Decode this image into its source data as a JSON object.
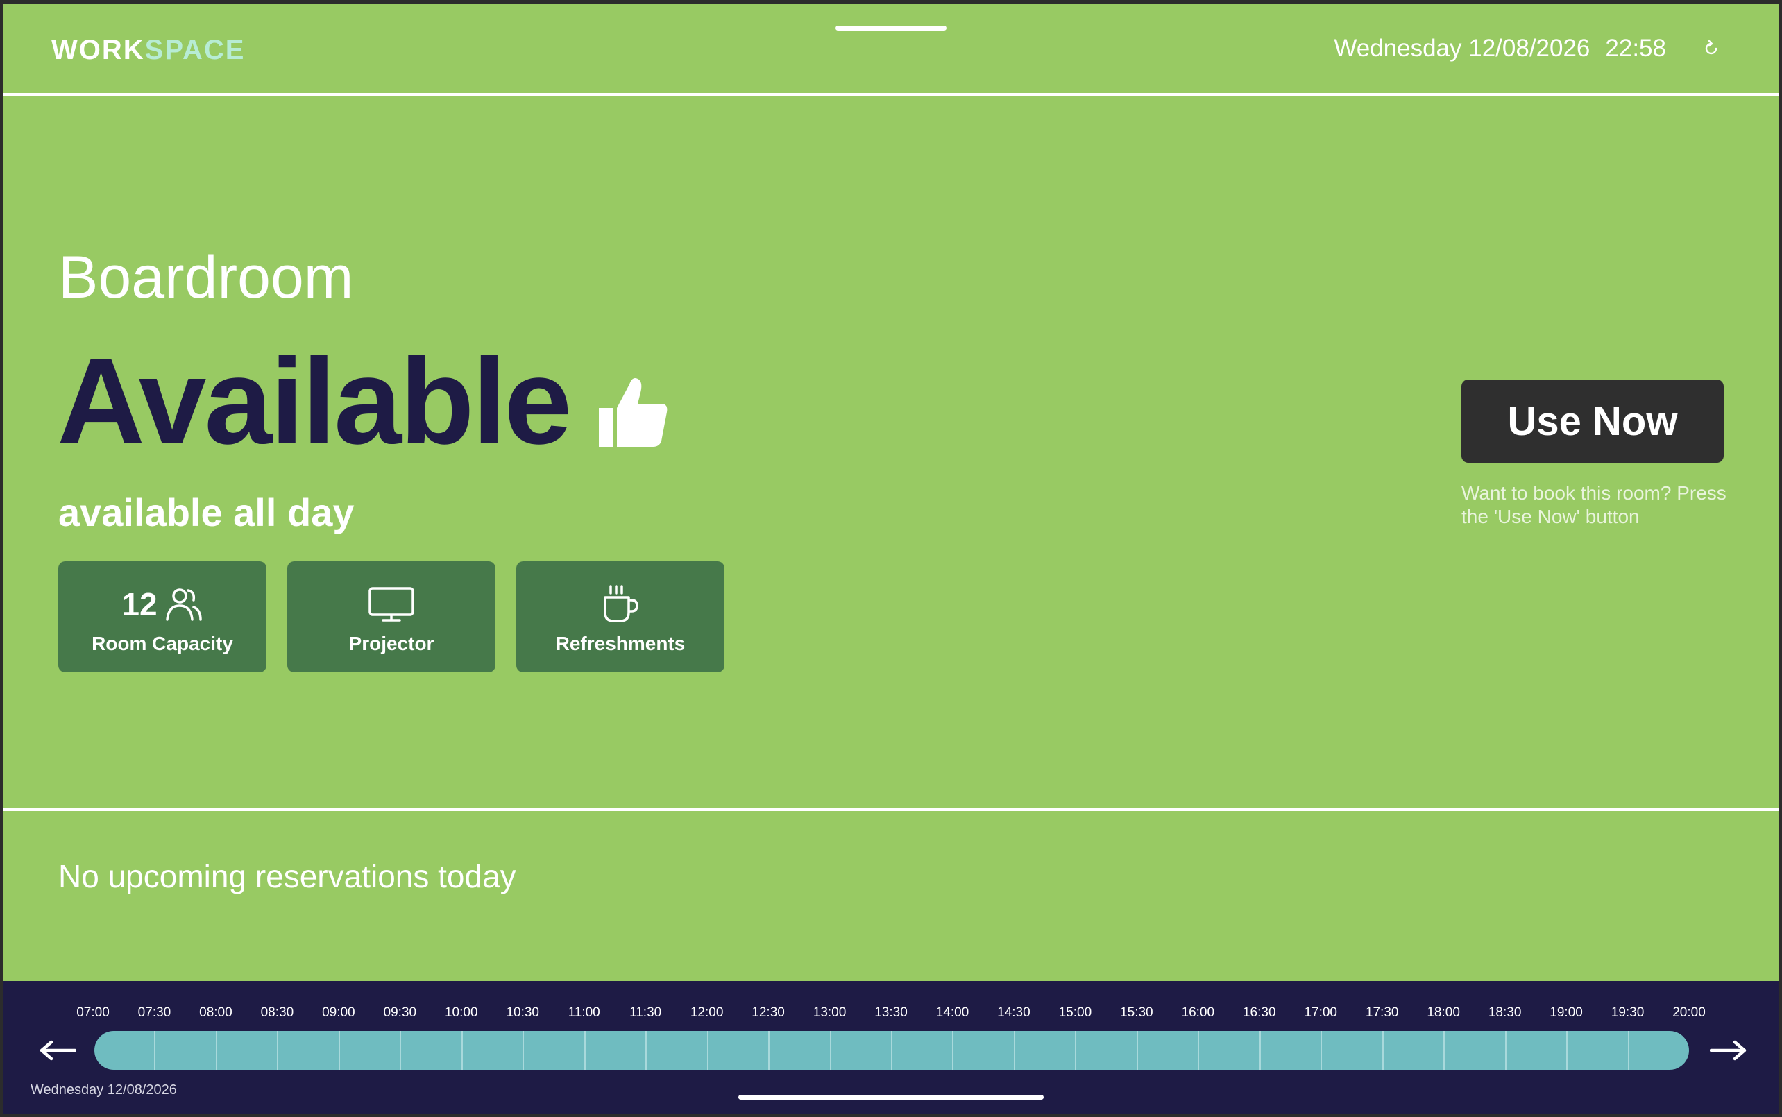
{
  "header": {
    "logo_part1": "WORK",
    "logo_part2": "SPACE",
    "date": "Wednesday 12/08/2026",
    "time": "22:58",
    "refresh_icon": "refresh-icon"
  },
  "room": {
    "name": "Boardroom",
    "status": "Available",
    "status_icon": "thumbs-up-icon",
    "status_detail": "available all day"
  },
  "features": {
    "capacity_value": "12",
    "capacity_label": "Room Capacity",
    "capacity_icon": "people-icon",
    "projector_label": "Projector",
    "projector_icon": "monitor-icon",
    "refreshments_label": "Refreshments",
    "refreshments_icon": "coffee-cup-icon"
  },
  "booking": {
    "button_label": "Use Now",
    "hint": "Want to book this room? Press the 'Use Now' button"
  },
  "reservations": {
    "empty_message": "No upcoming reservations today"
  },
  "timeline": {
    "times": [
      "07:00",
      "07:30",
      "08:00",
      "08:30",
      "09:00",
      "09:30",
      "10:00",
      "10:30",
      "11:00",
      "11:30",
      "12:00",
      "12:30",
      "13:00",
      "13:30",
      "14:00",
      "14:30",
      "15:00",
      "15:30",
      "16:00",
      "16:30",
      "17:00",
      "17:30",
      "18:00",
      "18:30",
      "19:00",
      "19:30",
      "20:00"
    ],
    "date": "Wednesday 12/08/2026",
    "prev_icon": "arrow-left-icon",
    "next_icon": "arrow-right-icon"
  },
  "colors": {
    "background": "#98ca63",
    "status_text": "#1e1b45",
    "feature_tile": "#46794a",
    "button": "#2f2f2f",
    "timeline_bg": "#1e1b45",
    "timeline_bar": "#6fbcc0"
  }
}
